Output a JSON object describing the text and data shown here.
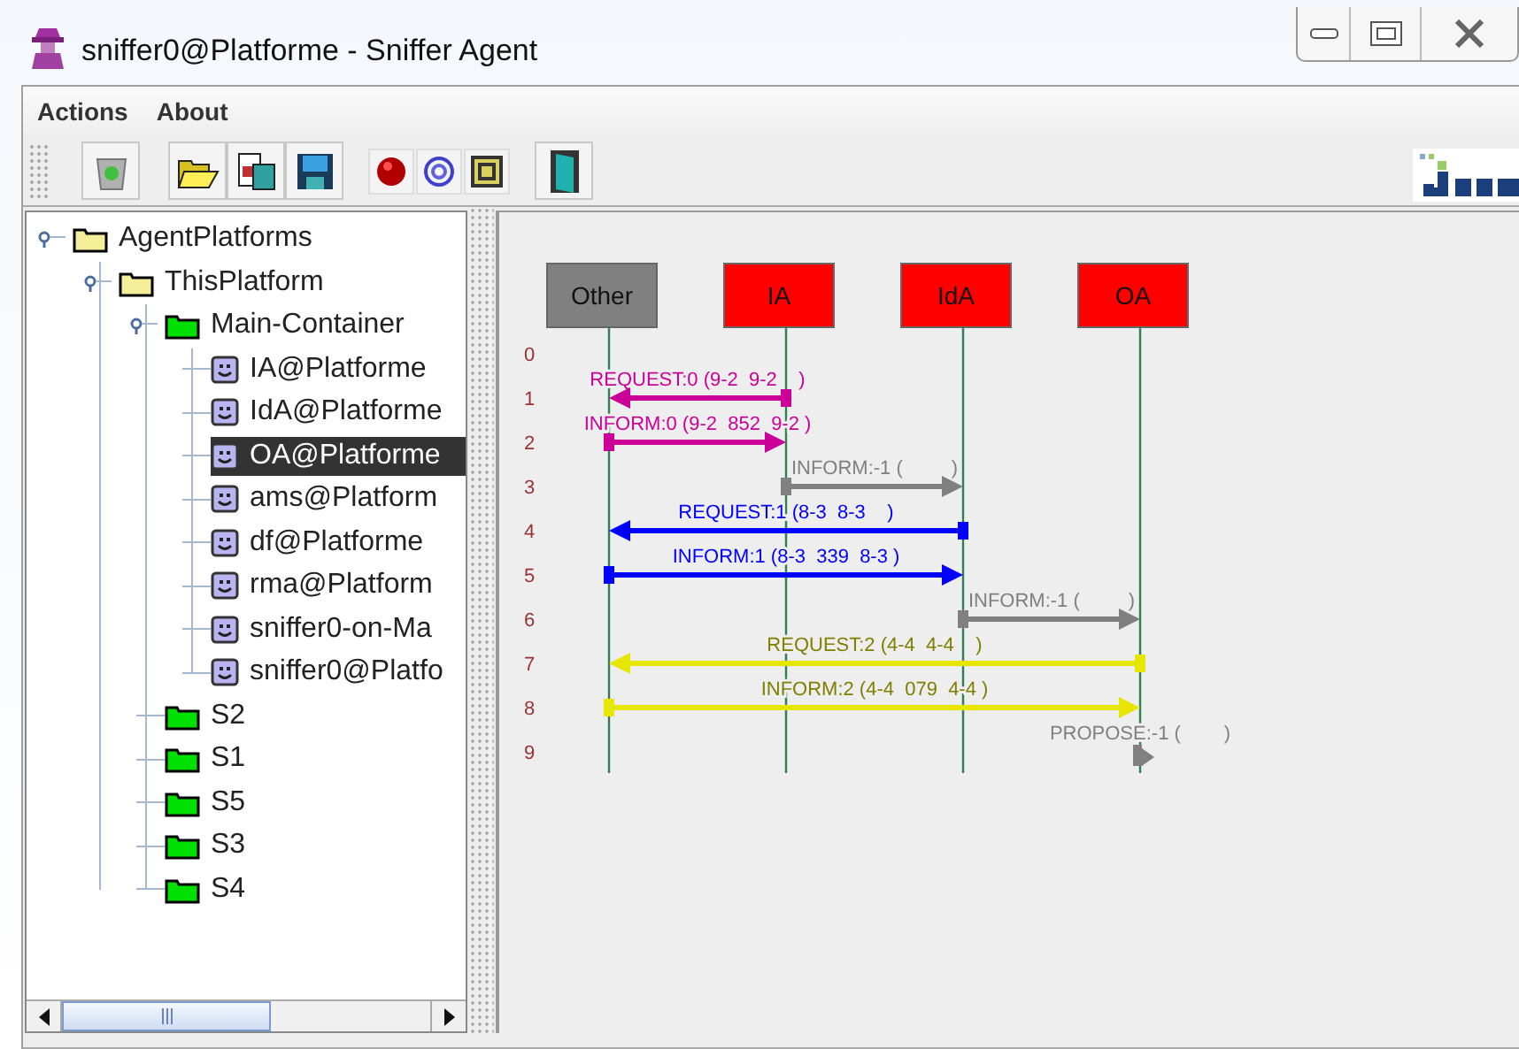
{
  "window": {
    "title": "sniffer0@Platforme - Sniffer Agent"
  },
  "menu": [
    "Actions",
    "About"
  ],
  "tree": [
    {
      "label": "AgentPlatforms",
      "kind": "platforms",
      "expanded": true,
      "selected": false,
      "children": [
        {
          "label": "ThisPlatform",
          "kind": "platform",
          "expanded": true,
          "selected": false,
          "children": [
            {
              "label": "Main-Container",
              "kind": "container",
              "expanded": true,
              "selected": false,
              "children": [
                {
                  "label": "IA@Platforme",
                  "kind": "agent",
                  "selected": false
                },
                {
                  "label": "IdA@Platforme",
                  "kind": "agent",
                  "selected": false
                },
                {
                  "label": "OA@Platforme",
                  "kind": "agent",
                  "selected": true
                },
                {
                  "label": "ams@Platform",
                  "kind": "agent",
                  "selected": false
                },
                {
                  "label": "df@Platforme",
                  "kind": "agent",
                  "selected": false
                },
                {
                  "label": "rma@Platform",
                  "kind": "agent",
                  "selected": false
                },
                {
                  "label": "sniffer0-on-Ma",
                  "kind": "agent",
                  "selected": false
                },
                {
                  "label": "sniffer0@Platfo",
                  "kind": "agent",
                  "selected": false
                }
              ]
            },
            {
              "label": "S2",
              "kind": "container",
              "expanded": false,
              "selected": false
            },
            {
              "label": "S1",
              "kind": "container",
              "expanded": false,
              "selected": false
            },
            {
              "label": "S5",
              "kind": "container",
              "expanded": false,
              "selected": false
            },
            {
              "label": "S3",
              "kind": "container",
              "expanded": false,
              "selected": false
            },
            {
              "label": "S4",
              "kind": "container",
              "expanded": false,
              "selected": false
            }
          ]
        }
      ]
    }
  ],
  "diagram": {
    "agents": [
      {
        "name": "Other",
        "color": "#808080"
      },
      {
        "name": "IA",
        "color": "#ff0000"
      },
      {
        "name": "IdA",
        "color": "#ff0000"
      },
      {
        "name": "OA",
        "color": "#ff0000"
      }
    ],
    "rows": [
      "0",
      "1",
      "2",
      "3",
      "4",
      "5",
      "6",
      "7",
      "8",
      "9"
    ],
    "messages": [
      {
        "label": "REQUEST:0 (9-2  9-2    )",
        "kind": "left",
        "lanes": [
          true,
          true,
          false,
          false
        ],
        "color": "#cc0099"
      },
      {
        "label": "INFORM:0 (9-2  852  9-2 )",
        "kind": "right",
        "lanes": [
          true,
          true,
          false,
          false
        ],
        "color": "#cc0099"
      },
      {
        "label": "INFORM:-1 (         )",
        "kind": "right",
        "lanes": [
          false,
          true,
          true,
          false
        ],
        "color": "#808080"
      },
      {
        "label": "REQUEST:1 (8-3  8-3    )",
        "kind": "left",
        "lanes": [
          true,
          false,
          true,
          false
        ],
        "color": "#0000ff"
      },
      {
        "label": "INFORM:1 (8-3  339  8-3 )",
        "kind": "right",
        "lanes": [
          true,
          false,
          true,
          false
        ],
        "color": "#0000ff"
      },
      {
        "label": "INFORM:-1 (         )",
        "kind": "right",
        "lanes": [
          false,
          false,
          true,
          true
        ],
        "color": "#808080"
      },
      {
        "label": "REQUEST:2 (4-4  4-4    )",
        "kind": "left",
        "lanes": [
          true,
          false,
          false,
          true
        ],
        "color": "#e6e600"
      },
      {
        "label": "INFORM:2 (4-4  079  4-4 )",
        "kind": "right",
        "lanes": [
          true,
          false,
          false,
          true
        ],
        "color": "#e6e600"
      },
      {
        "label": "PROPOSE:-1 (        )",
        "kind": "self",
        "lanes": [
          false,
          false,
          false,
          true
        ],
        "color": "#808080"
      }
    ]
  }
}
